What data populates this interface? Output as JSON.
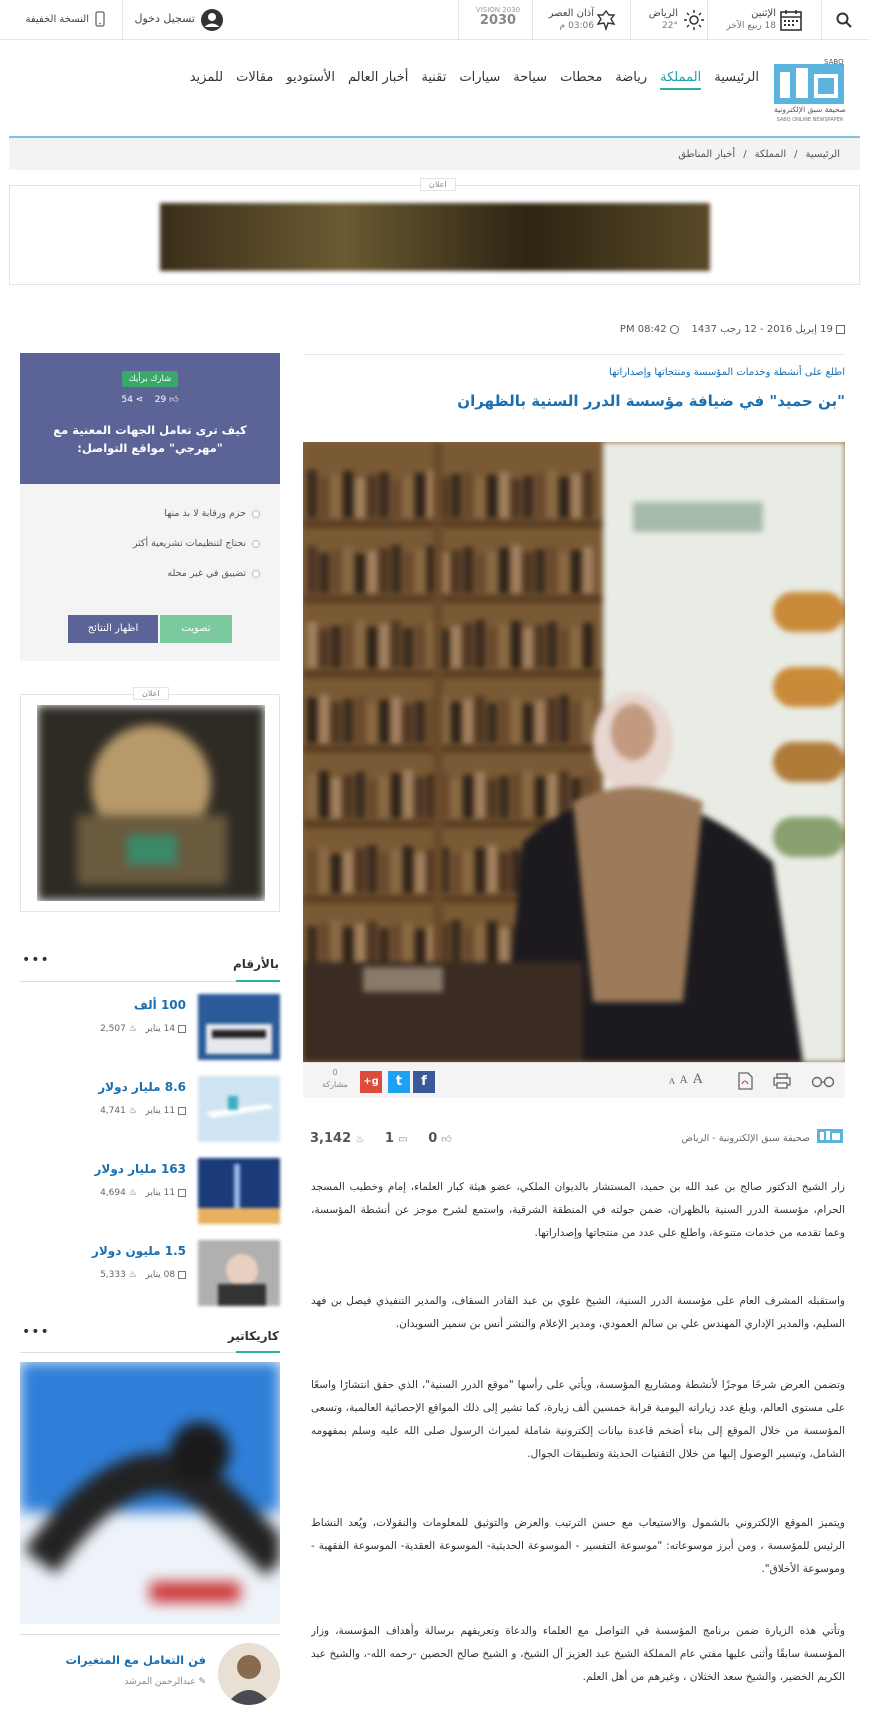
{
  "topbar": {
    "date_label": "الإثنين",
    "hijri_date": "18 ربيع الآخر",
    "weather_city": "الرياض",
    "weather_temp": "22°",
    "prayer_label": "آذان العصر",
    "prayer_time": "03:06 م",
    "vision": "VISION 2030",
    "login_label": "تسجيل دخول",
    "light_version_label": "النسخة الخفيفة"
  },
  "logo": {
    "text": "سبق",
    "tag": "SABQ",
    "subtitle": "صحيفة سبق الإلكترونية",
    "subtitle_en": "SABQ ONLINE NEWSPAPER"
  },
  "nav": {
    "items": [
      "الرئيسية",
      "المملكة",
      "رياضة",
      "محطات",
      "سياحة",
      "سيارات",
      "تقنية",
      "أخبار العالم",
      "الأستوديو",
      "مقالات",
      "للمزيد"
    ],
    "active": "المملكة"
  },
  "breadcrumb": [
    "الرئيسية",
    "المملكة",
    "أخبار المناطق"
  ],
  "ad_label": "اعلان",
  "article": {
    "date": "19 إبريل 2016 - 12 رجب 1437",
    "time": "PM 08:42",
    "overline": "اطلع على أنشطة وخدمات المؤسسة ومنتجاتها وإصداراتها",
    "title": "\"بن حميد\" في ضيافة مؤسسة الدرر السنية بالظهران",
    "share_count": "0",
    "share_label": "مشاركة",
    "source": "صحيفة سبق الإلكترونية - الرياض",
    "views": "3,142",
    "comments": "1",
    "likes": "0",
    "paragraphs": [
      "زار الشيخ الدكتور صالح بن عبد الله بن حميد، المستشار بالديوان الملكي، عضو هيئة كبار العلماء، إمام وخطيب المسجد الحرام، مؤسسة الدرر السنية بالظهران، ضمن جولته في المنطقة الشرقية، واستمع لشرح موجز عن أنشطة المؤسسة، وعما تقدمه من خدمات متنوعة، واطلع على عدد من منتجاتها وإصداراتها.",
      "واستقبله المشرف العام على مؤسسة الدرر السنية، الشيخ علوي بن عبد القادر السقاف، والمدير التنفيذي فيصل بن فهد السليم، والمدير الإداري المهندس علي بن سالم العمودي، ومدير الإعلام والنشر أنس بن سمير السويدان.",
      "وتضمن العرض شرحًا موجزًا لأنشطة ومشاريع المؤسسة، ويأتي على رأسها \"موقع الدرر السنية\"، الذي حقق انتشارًا واسعًا على مستوى العالم، وبلغ عدد زياراته اليومية قرابة خمسين ألف زيارة، كما تشير إلى ذلك المواقع الإحصائية العالمية، وتسعى المؤسسة من خلال الموقع إلى بناء أضخم قاعدة بيانات إلكترونية شاملة لميراث الرسول صلى الله عليه وسلم بمفهومه الشامل، وتيسير الوصول إليها من خلال التقنيات الحديثة وتطبيقات الجوال.",
      "ويتميز الموقع الإلكتروني بالشمول والاستيعاب مع حسن الترتيب والعرض والتوثيق للمعلومات والنقولات، ويُعد النشاط الرئيس للمؤسسة ، ومن أبرز موسوعاته: \"موسوعة التفسير - الموسوعة الحديثية- الموسوعة العقدية- الموسوعة الفقهية - وموسوعة الأخلاق\".",
      "وتأتي هذه الزيارة ضمن برنامج المؤسسة في التواصل مع العلماء والدعاة وتعريفهم برسالة وأهداف المؤسسة، وزار المؤسسة سابقًا وأثنى عليها مفتي عام المملكة الشيخ عبد العزيز آل الشيخ، و الشيخ صالح الحصين -رحمه الله-، والشيخ عبد الكريم الخضير، والشيخ سعد الخثلان ، وغيرهم من أهل العلم."
    ]
  },
  "poll": {
    "badge": "شارك برأيك",
    "likes": "29",
    "shares": "54",
    "question": "كيف ترى تعامل الجهات المعنية مع \"مهرجي\" مواقع التواصل:",
    "options": [
      "حزم ورقابة لا بد منها",
      "نحتاج لتنظيمات تشريعية أكثر",
      "تضييق في غير محله"
    ],
    "vote_label": "تصويت",
    "results_label": "اظهار النتائج",
    "vote_color": "#7cc9a0",
    "results_color": "#5c6497"
  },
  "numbers": {
    "title": "بالأرقام",
    "items": [
      {
        "title": "100 ألف",
        "date": "14 يناير",
        "views": "2,507"
      },
      {
        "title": "8.6 مليار دولار",
        "date": "11 يناير",
        "views": "4,741"
      },
      {
        "title": "163 مليار دولار",
        "date": "11 يناير",
        "views": "4,694"
      },
      {
        "title": "1.5 مليون دولار",
        "date": "08 يناير",
        "views": "5,333"
      }
    ]
  },
  "caricature": {
    "title": "كاريكاتير"
  },
  "author": {
    "title": "فن التعامل مع المتغيرات",
    "name": "عبدالرحمن المرشد"
  },
  "colors": {
    "accent": "#1a6fb0",
    "teal": "#2ab0a0",
    "poll_bg": "#5c6497"
  }
}
